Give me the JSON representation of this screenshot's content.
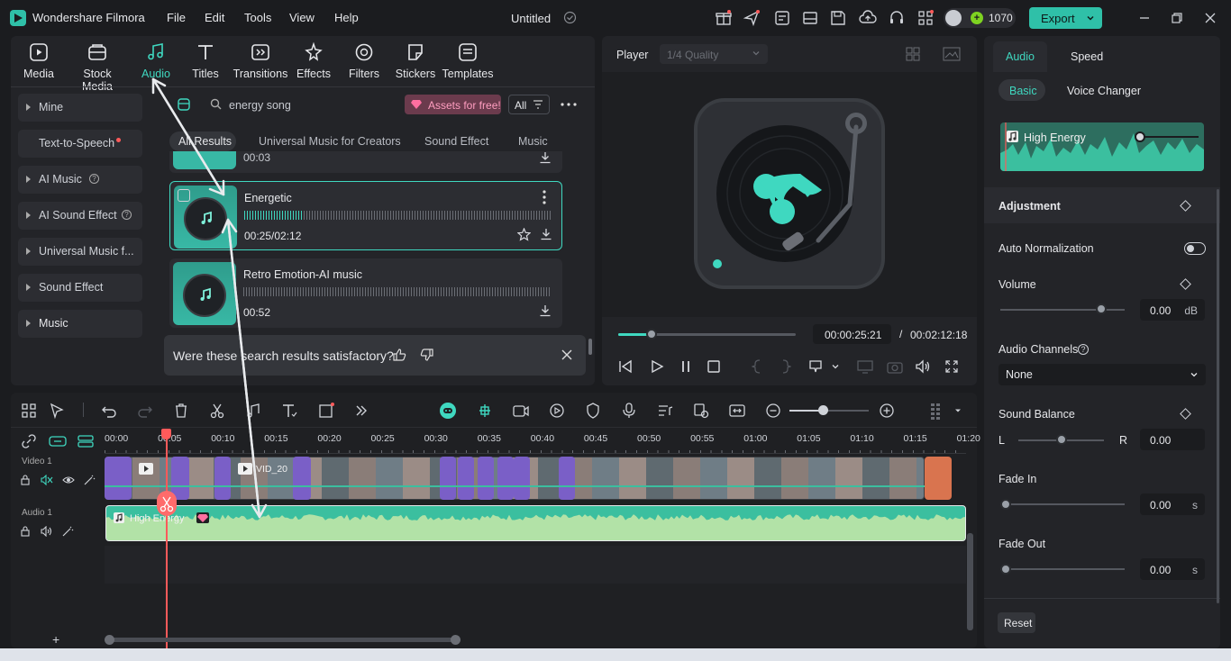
{
  "app": {
    "name": "Wondershare Filmora",
    "menu": [
      "File",
      "Edit",
      "Tools",
      "View",
      "Help"
    ],
    "project_title": "Untitled",
    "credits": "1070",
    "export_label": "Export"
  },
  "media_tabs": [
    {
      "label": "Media",
      "icon": "media-icon"
    },
    {
      "label": "Stock Media",
      "icon": "stock-media-icon"
    },
    {
      "label": "Audio",
      "icon": "audio-note-icon",
      "active": true
    },
    {
      "label": "Titles",
      "icon": "titles-icon"
    },
    {
      "label": "Transitions",
      "icon": "transitions-icon"
    },
    {
      "label": "Effects",
      "icon": "effects-icon"
    },
    {
      "label": "Filters",
      "icon": "filters-icon"
    },
    {
      "label": "Stickers",
      "icon": "stickers-icon"
    },
    {
      "label": "Templates",
      "icon": "templates-icon"
    }
  ],
  "sidebar": {
    "items": [
      {
        "label": "Mine",
        "expandable": true
      },
      {
        "label": "Text-to-Speech",
        "expandable": false
      },
      {
        "label": "AI Music",
        "expandable": true
      },
      {
        "label": "AI Sound Effect",
        "expandable": true
      },
      {
        "label": "Universal Music f...",
        "expandable": true
      },
      {
        "label": "Sound Effect",
        "expandable": true
      },
      {
        "label": "Music",
        "expandable": true
      }
    ]
  },
  "search": {
    "value": "energy song",
    "assets_label": "Assets for free!",
    "filter_label": "All"
  },
  "categories": [
    "All Results",
    "Universal Music for Creators",
    "Sound Effect",
    "Music"
  ],
  "results": [
    {
      "title": "",
      "time": "00:03"
    },
    {
      "title": "Energetic",
      "time": "00:25/02:12",
      "selected": true
    },
    {
      "title": "Retro Emotion-AI music",
      "time": "00:52"
    }
  ],
  "feedback": {
    "question": "Were these search results satisfactory?"
  },
  "player": {
    "label": "Player",
    "quality": "1/4 Quality",
    "current_time": "00:00:25:21",
    "separator": "/",
    "total_time": "00:02:12:18",
    "progress": 0.19
  },
  "right_panel": {
    "tabs": [
      "Audio",
      "Speed"
    ],
    "subtabs": [
      "Basic",
      "Voice Changer"
    ],
    "clip_name": "High Energy",
    "section_title": "Adjustment",
    "auto_normalization_label": "Auto Normalization",
    "volume_label": "Volume",
    "volume_value": "0.00",
    "volume_unit": "dB",
    "volume_level": 0.81,
    "audio_channels_label": "Audio Channels",
    "audio_channels_value": "None",
    "sound_balance_label": "Sound Balance",
    "balance_left": "L",
    "balance_right": "R",
    "balance_value": "0.00",
    "balance_level": 0.5,
    "fade_in_label": "Fade In",
    "fade_in_value": "0.00",
    "fade_out_label": "Fade Out",
    "fade_out_value": "0.00",
    "seconds_unit": "s",
    "reset_label": "Reset"
  },
  "timeline": {
    "ruler": [
      "00:00",
      "00:05",
      "00:10",
      "00:15",
      "00:20",
      "00:25",
      "00:30",
      "00:35",
      "00:40",
      "00:45",
      "00:50",
      "00:55",
      "01:00",
      "01:05",
      "01:10",
      "01:15",
      "01:20"
    ],
    "video_track_label": "Video 1",
    "audio_track_label": "Audio 1",
    "audio_clip_name": "High Energy",
    "video_clip_name": "VID_20"
  },
  "colors": {
    "accent": "#3fd8c0",
    "export": "#2fc0a8",
    "playhead": "#ff5a5a",
    "audio_clip": "#3bbf9f",
    "video_purple": "#7a5fc7"
  }
}
